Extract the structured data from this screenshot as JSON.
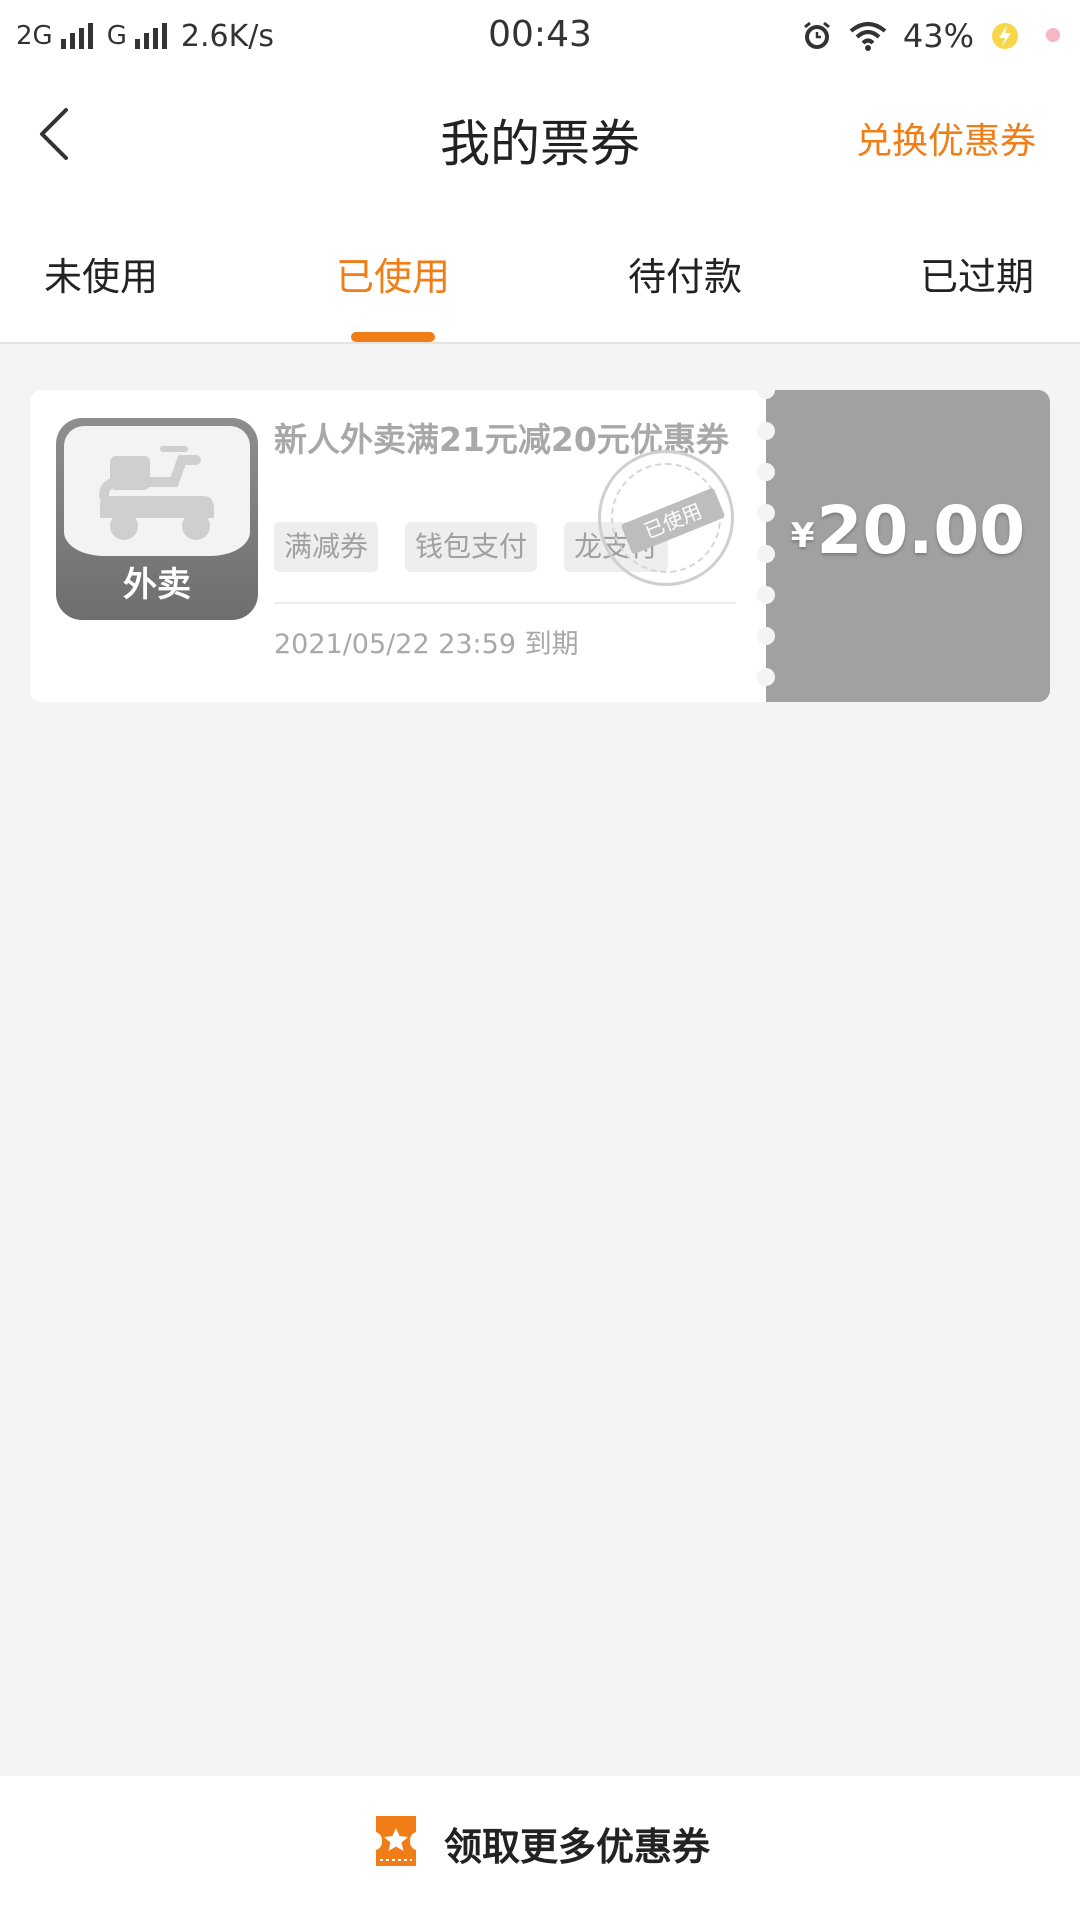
{
  "status_bar": {
    "network_1": "2G",
    "network_2": "G",
    "speed": "2.6K/s",
    "time": "00:43",
    "battery": "43%"
  },
  "header": {
    "title": "我的票券",
    "exchange_label": "兑换优惠券"
  },
  "tabs": [
    {
      "label": "未使用",
      "active": false
    },
    {
      "label": "已使用",
      "active": true
    },
    {
      "label": "待付款",
      "active": false
    },
    {
      "label": "已过期",
      "active": false
    }
  ],
  "coupon": {
    "icon_label": "外卖",
    "title": "新人外卖满21元减20元优惠券",
    "tags": [
      "满减券",
      "钱包支付",
      "龙支付"
    ],
    "expiry": "2021/05/22 23:59 到期",
    "stamp": "已使用",
    "currency": "¥",
    "amount": "20.00"
  },
  "bottom": {
    "action_label": "领取更多优惠券"
  },
  "colors": {
    "accent": "#f07d15",
    "used_gray": "#a1a1a1",
    "background": "#f4f4f4"
  },
  "icons": {
    "back": "chevron-left-icon",
    "coupon_app": "scooter-icon",
    "bottom": "ticket-icon"
  }
}
